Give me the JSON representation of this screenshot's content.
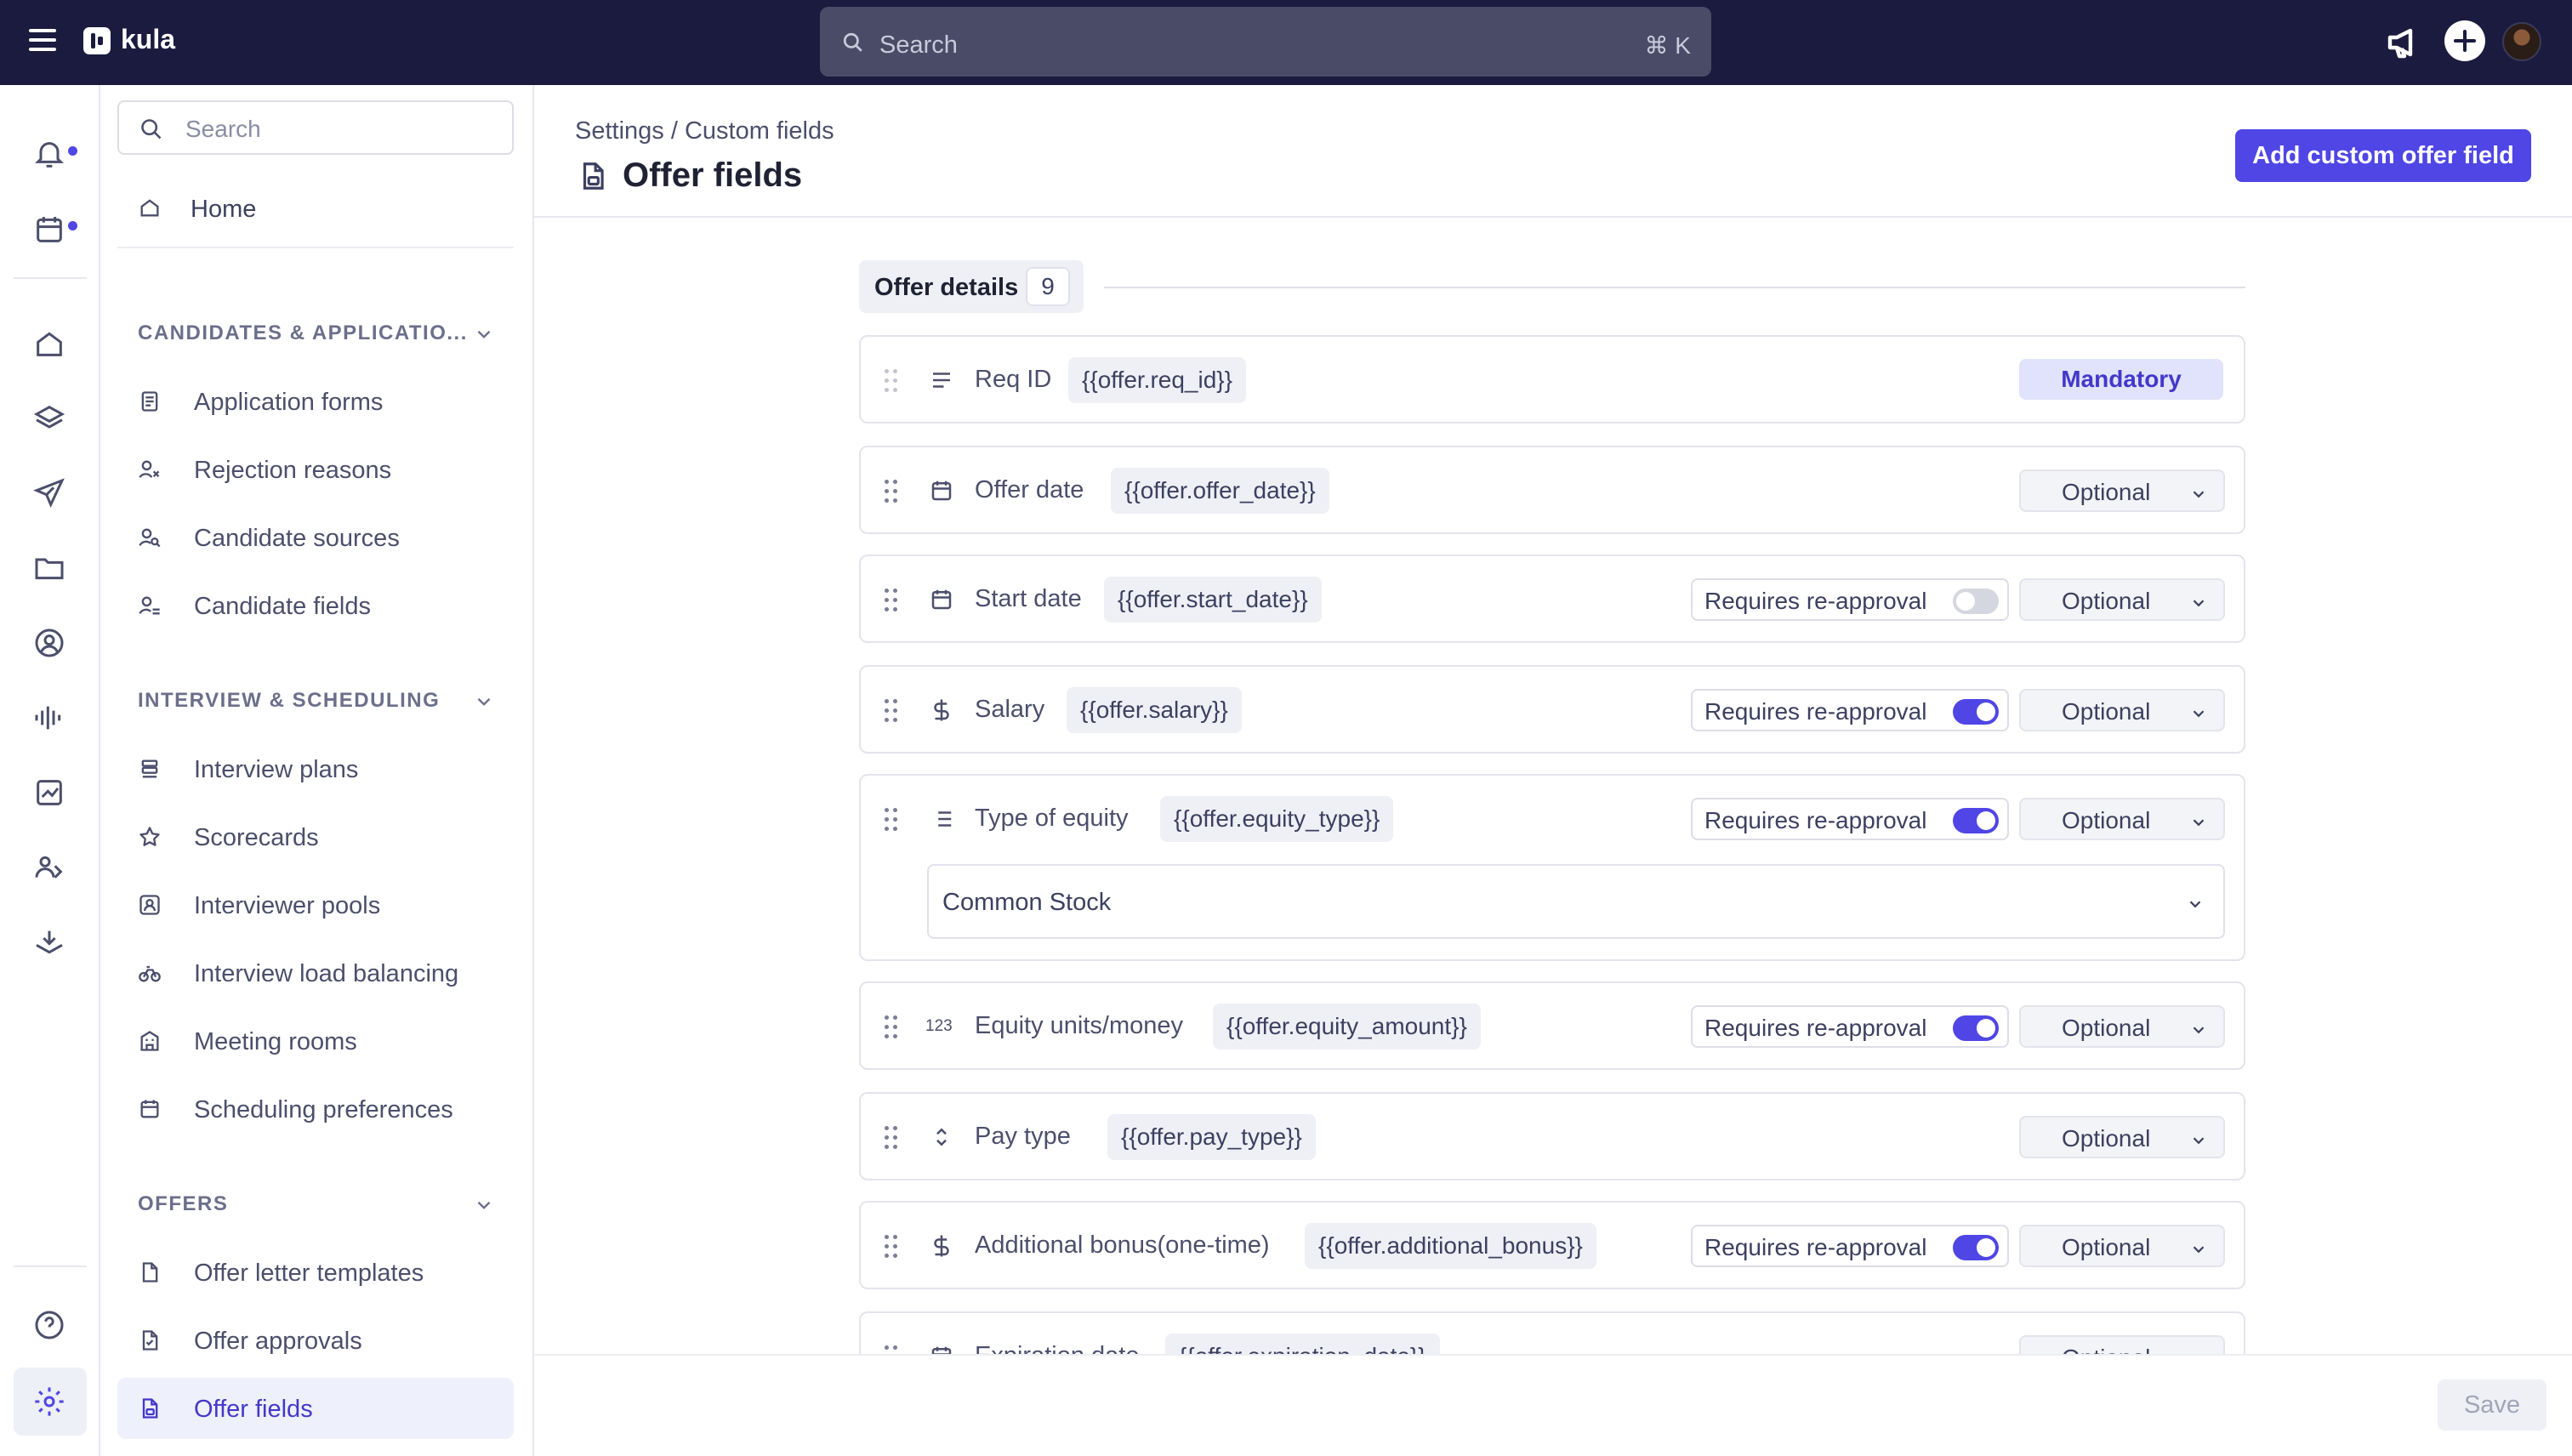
{
  "app": {
    "name": "kula"
  },
  "topbar": {
    "search_placeholder": "Search",
    "search_shortcut": "⌘ K"
  },
  "sidebar": {
    "search_placeholder": "Search",
    "home_label": "Home",
    "sections": [
      {
        "title": "CANDIDATES & APPLICATIO...",
        "items": [
          {
            "label": "Application forms",
            "icon": "file-text-icon"
          },
          {
            "label": "Rejection reasons",
            "icon": "user-x-icon"
          },
          {
            "label": "Candidate sources",
            "icon": "user-search-icon"
          },
          {
            "label": "Candidate fields",
            "icon": "user-fields-icon"
          }
        ]
      },
      {
        "title": "INTERVIEW & SCHEDULING",
        "items": [
          {
            "label": "Interview plans",
            "icon": "layers-icon"
          },
          {
            "label": "Scorecards",
            "icon": "star-icon"
          },
          {
            "label": "Interviewer pools",
            "icon": "user-square-icon"
          },
          {
            "label": "Interview load balancing",
            "icon": "bicycle-icon"
          },
          {
            "label": "Meeting rooms",
            "icon": "building-icon"
          },
          {
            "label": "Scheduling preferences",
            "icon": "calendar-icon"
          }
        ]
      },
      {
        "title": "OFFERS",
        "items": [
          {
            "label": "Offer letter templates",
            "icon": "file-icon"
          },
          {
            "label": "Offer approvals",
            "icon": "file-check-icon"
          },
          {
            "label": "Offer fields",
            "icon": "file-settings-icon",
            "active": true
          }
        ]
      }
    ]
  },
  "header": {
    "breadcrumb": "Settings / Custom fields",
    "title": "Offer fields",
    "add_button": "Add custom offer field"
  },
  "group": {
    "label": "Offer details",
    "count": "9"
  },
  "common": {
    "mandatory": "Mandatory",
    "optional": "Optional",
    "requires_reapproval": "Requires re-approval"
  },
  "fields": [
    {
      "name": "Req ID",
      "token": "{{offer.req_id}}",
      "icon": "text-lines-icon",
      "status": "Mandatory"
    },
    {
      "name": "Offer date",
      "token": "{{offer.offer_date}}",
      "icon": "calendar-icon",
      "status": "Optional"
    },
    {
      "name": "Start date",
      "token": "{{offer.start_date}}",
      "icon": "calendar-icon",
      "status": "Optional",
      "requires_reapproval": false
    },
    {
      "name": "Salary",
      "token": "{{offer.salary}}",
      "icon": "dollar-icon",
      "status": "Optional",
      "requires_reapproval": true
    },
    {
      "name": "Type of equity",
      "token": "{{offer.equity_type}}",
      "icon": "list-icon",
      "status": "Optional",
      "requires_reapproval": true,
      "default_value": "Common Stock"
    },
    {
      "name": "Equity units/money",
      "token": "{{offer.equity_amount}}",
      "icon": "number-123-icon",
      "status": "Optional",
      "requires_reapproval": true
    },
    {
      "name": "Pay type",
      "token": "{{offer.pay_type}}",
      "icon": "chevrons-updown-icon",
      "status": "Optional"
    },
    {
      "name": "Additional bonus(one-time)",
      "token": "{{offer.additional_bonus}}",
      "icon": "dollar-icon",
      "status": "Optional",
      "requires_reapproval": true
    },
    {
      "name": "Expiration date",
      "token": "{{offer.expiration_date}}",
      "icon": "calendar-icon",
      "status": "Optional"
    }
  ],
  "footer": {
    "save_label": "Save"
  },
  "colors": {
    "accent": "#4f46e5",
    "topbar": "#1a1b3f",
    "toggle_off": "#d5d7e0"
  }
}
